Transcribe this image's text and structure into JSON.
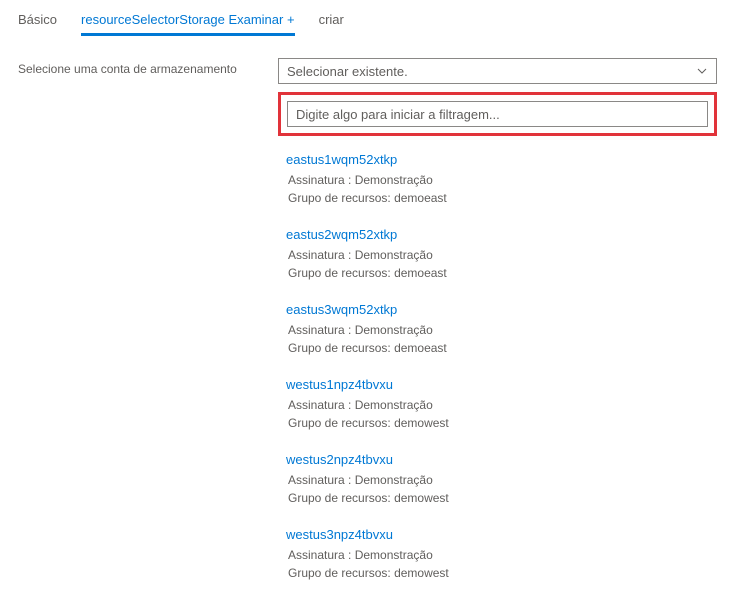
{
  "tabs": {
    "basic": "Básico",
    "resource": "resourceSelectorStorage Examinar +",
    "create": "criar"
  },
  "form": {
    "label": "Selecione uma conta de armazenamento",
    "selectPlaceholder": "Selecionar existente.",
    "filterPlaceholder": "Digite algo para iniciar a filtragem..."
  },
  "subscriptionLabel": "Assinatura : ",
  "resourceGroupLabel": "Grupo de recursos: ",
  "results": [
    {
      "name": "eastus1wqm52xtkp",
      "subscription": "Demonstração",
      "resourceGroup": "demoeast"
    },
    {
      "name": "eastus2wqm52xtkp",
      "subscription": "Demonstração",
      "resourceGroup": "demoeast"
    },
    {
      "name": "eastus3wqm52xtkp",
      "subscription": "Demonstração",
      "resourceGroup": "demoeast"
    },
    {
      "name": "westus1npz4tbvxu",
      "subscription": "Demonstração",
      "resourceGroup": "demowest"
    },
    {
      "name": "westus2npz4tbvxu",
      "subscription": "Demonstração",
      "resourceGroup": "demowest"
    },
    {
      "name": "westus3npz4tbvxu",
      "subscription": "Demonstração",
      "resourceGroup": "demowest"
    }
  ]
}
